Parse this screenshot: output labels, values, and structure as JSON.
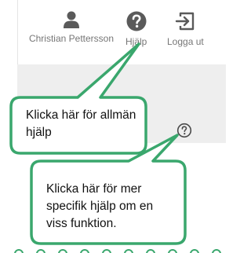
{
  "header": {
    "user_name": "Christian Pettersson",
    "help_label": "Hjälp",
    "logout_label": "Logga ut",
    "icons": {
      "user": "user-icon",
      "help": "help-circle-icon",
      "logout": "logout-icon"
    }
  },
  "content": {
    "context_help_icon": "help-circle-icon"
  },
  "callouts": {
    "general_help_text": "Klicka här för allmän hjälp",
    "specific_help_text": "Klicka här för mer specifik hjälp om en viss funktion."
  },
  "colors": {
    "accent_green": "#3aa76d",
    "icon_dark": "#5a5a5a",
    "label_grey": "#767676",
    "content_grey": "#eeeeee"
  }
}
